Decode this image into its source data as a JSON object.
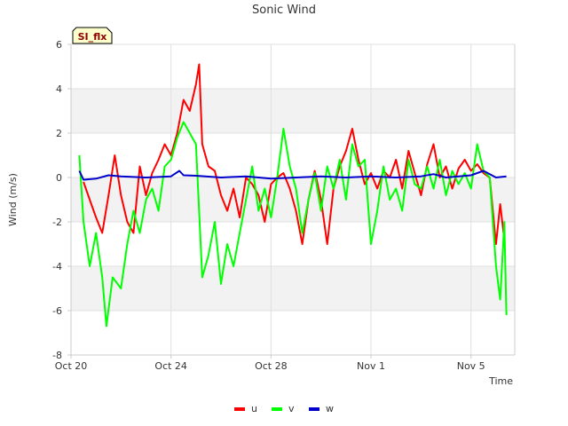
{
  "chart_data": {
    "type": "line",
    "title": "Sonic Wind",
    "tag": "SI_flx",
    "xlabel": "Time",
    "ylabel": "Wind (m/s)",
    "xlim": [
      "2023-10-20",
      "2023-11-06 18:00"
    ],
    "ylim": [
      -8,
      6
    ],
    "yticks": [
      -8,
      -6,
      -4,
      -2,
      0,
      2,
      4,
      6
    ],
    "xticks": [
      {
        "t": "2023-10-20",
        "label": "Oct 20"
      },
      {
        "t": "2023-10-24",
        "label": "Oct 24"
      },
      {
        "t": "2023-10-28",
        "label": "Oct 28"
      },
      {
        "t": "2023-11-01",
        "label": "Nov 1"
      },
      {
        "t": "2023-11-05",
        "label": "Nov 5"
      }
    ],
    "grid": true,
    "legend_position": "bottom",
    "series": [
      {
        "name": "u",
        "color": "#ff0000",
        "points": [
          [
            "2023-10-20 12:00",
            -0.2
          ],
          [
            "2023-10-20 18:00",
            -1.0
          ],
          [
            "2023-10-21 00:00",
            -1.8
          ],
          [
            "2023-10-21 06:00",
            -2.5
          ],
          [
            "2023-10-21 12:00",
            -0.8
          ],
          [
            "2023-10-21 18:00",
            1.0
          ],
          [
            "2023-10-22 00:00",
            -0.8
          ],
          [
            "2023-10-22 06:00",
            -2.0
          ],
          [
            "2023-10-22 12:00",
            -2.5
          ],
          [
            "2023-10-22 18:00",
            0.5
          ],
          [
            "2023-10-23 00:00",
            -0.8
          ],
          [
            "2023-10-23 06:00",
            0.2
          ],
          [
            "2023-10-23 12:00",
            0.8
          ],
          [
            "2023-10-23 18:00",
            1.5
          ],
          [
            "2023-10-24 00:00",
            1.0
          ],
          [
            "2023-10-24 06:00",
            2.0
          ],
          [
            "2023-10-24 12:00",
            3.5
          ],
          [
            "2023-10-24 18:00",
            3.0
          ],
          [
            "2023-10-25 00:00",
            4.2
          ],
          [
            "2023-10-25 03:00",
            5.1
          ],
          [
            "2023-10-25 06:00",
            1.5
          ],
          [
            "2023-10-25 12:00",
            0.5
          ],
          [
            "2023-10-25 18:00",
            0.3
          ],
          [
            "2023-10-26 00:00",
            -0.8
          ],
          [
            "2023-10-26 06:00",
            -1.5
          ],
          [
            "2023-10-26 12:00",
            -0.5
          ],
          [
            "2023-10-26 18:00",
            -1.8
          ],
          [
            "2023-10-27 00:00",
            0.0
          ],
          [
            "2023-10-27 06:00",
            -0.3
          ],
          [
            "2023-10-27 12:00",
            -0.8
          ],
          [
            "2023-10-27 18:00",
            -2.0
          ],
          [
            "2023-10-28 00:00",
            -0.3
          ],
          [
            "2023-10-28 06:00",
            0.0
          ],
          [
            "2023-10-28 12:00",
            0.2
          ],
          [
            "2023-10-28 18:00",
            -0.5
          ],
          [
            "2023-10-29 00:00",
            -1.5
          ],
          [
            "2023-10-29 06:00",
            -3.0
          ],
          [
            "2023-10-29 12:00",
            -1.0
          ],
          [
            "2023-10-29 18:00",
            0.3
          ],
          [
            "2023-10-30 00:00",
            -1.0
          ],
          [
            "2023-10-30 06:00",
            -3.0
          ],
          [
            "2023-10-30 12:00",
            -0.5
          ],
          [
            "2023-10-30 18:00",
            0.5
          ],
          [
            "2023-10-31 00:00",
            1.2
          ],
          [
            "2023-10-31 06:00",
            2.2
          ],
          [
            "2023-10-31 12:00",
            0.8
          ],
          [
            "2023-10-31 18:00",
            -0.3
          ],
          [
            "2023-11-01 00:00",
            0.2
          ],
          [
            "2023-11-01 06:00",
            -0.5
          ],
          [
            "2023-11-01 12:00",
            0.3
          ],
          [
            "2023-11-01 18:00",
            0.0
          ],
          [
            "2023-11-02 00:00",
            0.8
          ],
          [
            "2023-11-02 06:00",
            -0.5
          ],
          [
            "2023-11-02 12:00",
            1.2
          ],
          [
            "2023-11-02 18:00",
            0.2
          ],
          [
            "2023-11-03 00:00",
            -0.8
          ],
          [
            "2023-11-03 06:00",
            0.6
          ],
          [
            "2023-11-03 12:00",
            1.5
          ],
          [
            "2023-11-03 18:00",
            0.0
          ],
          [
            "2023-11-04 00:00",
            0.5
          ],
          [
            "2023-11-04 06:00",
            -0.5
          ],
          [
            "2023-11-04 12:00",
            0.4
          ],
          [
            "2023-11-04 18:00",
            0.8
          ],
          [
            "2023-11-05 00:00",
            0.3
          ],
          [
            "2023-11-05 06:00",
            0.6
          ],
          [
            "2023-11-05 12:00",
            0.2
          ],
          [
            "2023-11-05 18:00",
            0.0
          ],
          [
            "2023-11-06 00:00",
            -3.0
          ],
          [
            "2023-11-06 04:00",
            -1.2
          ],
          [
            "2023-11-06 08:00",
            -2.8
          ]
        ]
      },
      {
        "name": "v",
        "color": "#00ff00",
        "points": [
          [
            "2023-10-20 08:00",
            1.0
          ],
          [
            "2023-10-20 12:00",
            -2.0
          ],
          [
            "2023-10-20 18:00",
            -4.0
          ],
          [
            "2023-10-21 00:00",
            -2.5
          ],
          [
            "2023-10-21 06:00",
            -4.5
          ],
          [
            "2023-10-21 10:00",
            -6.7
          ],
          [
            "2023-10-21 16:00",
            -4.5
          ],
          [
            "2023-10-22 00:00",
            -5.0
          ],
          [
            "2023-10-22 06:00",
            -3.0
          ],
          [
            "2023-10-22 12:00",
            -1.5
          ],
          [
            "2023-10-22 18:00",
            -2.5
          ],
          [
            "2023-10-23 00:00",
            -1.0
          ],
          [
            "2023-10-23 06:00",
            -0.5
          ],
          [
            "2023-10-23 12:00",
            -1.5
          ],
          [
            "2023-10-23 18:00",
            0.5
          ],
          [
            "2023-10-24 00:00",
            0.8
          ],
          [
            "2023-10-24 06:00",
            1.8
          ],
          [
            "2023-10-24 12:00",
            2.5
          ],
          [
            "2023-10-24 18:00",
            2.0
          ],
          [
            "2023-10-25 00:00",
            1.5
          ],
          [
            "2023-10-25 06:00",
            -4.5
          ],
          [
            "2023-10-25 12:00",
            -3.5
          ],
          [
            "2023-10-25 18:00",
            -2.0
          ],
          [
            "2023-10-26 00:00",
            -4.8
          ],
          [
            "2023-10-26 06:00",
            -3.0
          ],
          [
            "2023-10-26 12:00",
            -4.0
          ],
          [
            "2023-10-26 18:00",
            -2.5
          ],
          [
            "2023-10-27 00:00",
            -1.0
          ],
          [
            "2023-10-27 06:00",
            0.5
          ],
          [
            "2023-10-27 12:00",
            -1.5
          ],
          [
            "2023-10-27 18:00",
            -0.5
          ],
          [
            "2023-10-28 00:00",
            -1.8
          ],
          [
            "2023-10-28 06:00",
            0.0
          ],
          [
            "2023-10-28 12:00",
            2.2
          ],
          [
            "2023-10-28 18:00",
            0.5
          ],
          [
            "2023-10-29 00:00",
            -0.5
          ],
          [
            "2023-10-29 06:00",
            -2.5
          ],
          [
            "2023-10-29 12:00",
            -1.0
          ],
          [
            "2023-10-29 18:00",
            0.2
          ],
          [
            "2023-10-30 00:00",
            -1.5
          ],
          [
            "2023-10-30 06:00",
            0.5
          ],
          [
            "2023-10-30 12:00",
            -0.5
          ],
          [
            "2023-10-30 18:00",
            0.8
          ],
          [
            "2023-10-31 00:00",
            -1.0
          ],
          [
            "2023-10-31 06:00",
            1.5
          ],
          [
            "2023-10-31 12:00",
            0.5
          ],
          [
            "2023-10-31 18:00",
            0.8
          ],
          [
            "2023-11-01 00:00",
            -3.0
          ],
          [
            "2023-11-01 06:00",
            -1.5
          ],
          [
            "2023-11-01 12:00",
            0.5
          ],
          [
            "2023-11-01 18:00",
            -1.0
          ],
          [
            "2023-11-02 00:00",
            -0.5
          ],
          [
            "2023-11-02 06:00",
            -1.5
          ],
          [
            "2023-11-02 12:00",
            0.8
          ],
          [
            "2023-11-02 18:00",
            -0.3
          ],
          [
            "2023-11-03 00:00",
            -0.5
          ],
          [
            "2023-11-03 06:00",
            0.5
          ],
          [
            "2023-11-03 12:00",
            -0.5
          ],
          [
            "2023-11-03 18:00",
            0.8
          ],
          [
            "2023-11-04 00:00",
            -0.8
          ],
          [
            "2023-11-04 06:00",
            0.3
          ],
          [
            "2023-11-04 12:00",
            -0.3
          ],
          [
            "2023-11-04 18:00",
            0.2
          ],
          [
            "2023-11-05 00:00",
            -0.5
          ],
          [
            "2023-11-05 06:00",
            1.5
          ],
          [
            "2023-11-05 12:00",
            0.3
          ],
          [
            "2023-11-05 18:00",
            0.0
          ],
          [
            "2023-11-06 00:00",
            -4.0
          ],
          [
            "2023-11-06 04:00",
            -5.5
          ],
          [
            "2023-11-06 08:00",
            -2.0
          ],
          [
            "2023-11-06 10:00",
            -6.2
          ]
        ]
      },
      {
        "name": "w",
        "color": "#0000cc",
        "points": [
          [
            "2023-10-20 08:00",
            0.3
          ],
          [
            "2023-10-20 12:00",
            -0.1
          ],
          [
            "2023-10-21 00:00",
            -0.05
          ],
          [
            "2023-10-21 12:00",
            0.1
          ],
          [
            "2023-10-22 00:00",
            0.05
          ],
          [
            "2023-10-23 00:00",
            0.0
          ],
          [
            "2023-10-24 00:00",
            0.05
          ],
          [
            "2023-10-24 08:00",
            0.3
          ],
          [
            "2023-10-24 12:00",
            0.1
          ],
          [
            "2023-10-25 00:00",
            0.08
          ],
          [
            "2023-10-26 00:00",
            0.0
          ],
          [
            "2023-10-27 00:00",
            0.05
          ],
          [
            "2023-10-28 00:00",
            -0.05
          ],
          [
            "2023-10-29 00:00",
            0.0
          ],
          [
            "2023-10-30 00:00",
            0.05
          ],
          [
            "2023-10-31 00:00",
            0.0
          ],
          [
            "2023-11-01 00:00",
            0.05
          ],
          [
            "2023-11-02 00:00",
            0.0
          ],
          [
            "2023-11-03 00:00",
            0.05
          ],
          [
            "2023-11-03 12:00",
            0.15
          ],
          [
            "2023-11-04 00:00",
            0.0
          ],
          [
            "2023-11-05 00:00",
            0.1
          ],
          [
            "2023-11-05 12:00",
            0.3
          ],
          [
            "2023-11-06 00:00",
            0.0
          ],
          [
            "2023-11-06 10:00",
            0.05
          ]
        ]
      }
    ]
  }
}
